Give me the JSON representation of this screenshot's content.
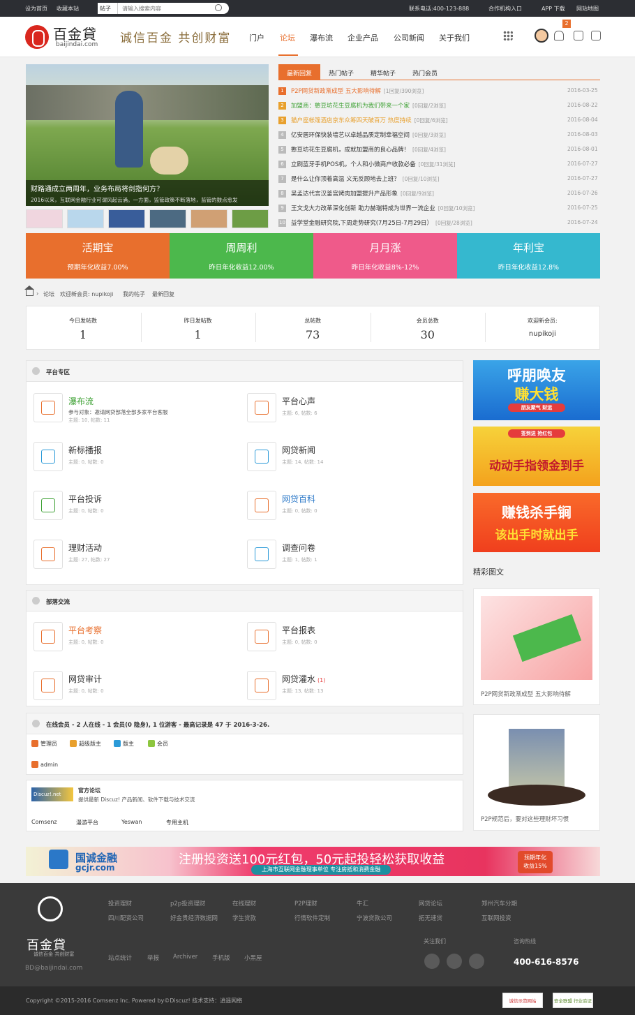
{
  "topbar": {
    "set_home": "设为首页",
    "bookmark": "收藏本站",
    "search_scope": "帖子",
    "search_placeholder": "请输入搜索内容",
    "phone": "联系电话:400-123-888",
    "partner": "合作机构入口",
    "app": "APP 下载",
    "sitemap": "网站地图"
  },
  "header": {
    "logo_text": "百金貸",
    "logo_domain": "baijindai.com",
    "slogan": "诚信百金 共创财富",
    "nav": [
      "门户",
      "论坛",
      "瀑布流",
      "企业产品",
      "公司新闻",
      "关于我们"
    ],
    "notif_count": "2"
  },
  "slider": {
    "title": "财路通成立两周年，业务布局将剑指何方？",
    "desc": "2016以来，互联网金融行业可谓风起云涌。一方面，监管政策不断落地，监管的鼓点愈发"
  },
  "tabs": [
    "最新回复",
    "热门帖子",
    "精华帖子",
    "热门会员"
  ],
  "latest": [
    {
      "n": "1",
      "title": "P2P网贷新政渐成型 五大影响待解",
      "meta": "[1回复/390浏览]",
      "date": "2016-03-25",
      "color": "#e86f2d"
    },
    {
      "n": "2",
      "title": "加盟商：憨豆坊花生豆腐机为我们带来一个家",
      "meta": "[0回复/2浏览]",
      "date": "2016-08-22",
      "color": "#3fa135"
    },
    {
      "n": "3",
      "title": "猫户座帐篷酒店京东众筹四天破百万 热度持续",
      "meta": "[0回复/6浏览]",
      "date": "2016-08-04",
      "color": "#e8a02d"
    },
    {
      "n": "4",
      "title": "亿安居环保快装墙艺以卓越品质定制幸福空间",
      "meta": "[0回复/3浏览]",
      "date": "2016-08-03",
      "color": "#333"
    },
    {
      "n": "5",
      "title": "憨豆坊花生豆腐机，成就加盟商的良心品牌！",
      "meta": "[0回复/4浏览]",
      "date": "2016-08-01",
      "color": "#333"
    },
    {
      "n": "6",
      "title": "立刷蓝牙手机POS机，个人和小微商户收款必备",
      "meta": "[0回复/31浏览]",
      "date": "2016-07-27",
      "color": "#333"
    },
    {
      "n": "7",
      "title": "是什么让你顶着高温 义无反顾地去上班？",
      "meta": "[0回复/10浏览]",
      "date": "2016-07-27",
      "color": "#333"
    },
    {
      "n": "8",
      "title": "吴孟达代言汉釜宫烤肉加盟提升产品形象",
      "meta": "[0回复/9浏览]",
      "date": "2016-07-26",
      "color": "#333"
    },
    {
      "n": "9",
      "title": "王文戈大力改革深化创新 助力赫瑞特成为世界一流企业",
      "meta": "[0回复/10浏览]",
      "date": "2016-07-25",
      "color": "#333"
    },
    {
      "n": "10",
      "title": "益学堂金融研究院,下周走势研究(7月25日-7月29日）",
      "meta": "[0回复/28浏览]",
      "date": "2016-07-24",
      "color": "#333"
    }
  ],
  "products": [
    {
      "name": "活期宝",
      "rate": "预期年化收益7.00%",
      "color": "#e86f2d"
    },
    {
      "name": "周周利",
      "rate": "昨日年化收益12.00%",
      "color": "#4cb84c"
    },
    {
      "name": "月月涨",
      "rate": "昨日年化收益8%-12%",
      "color": "#ef5a8a"
    },
    {
      "name": "年利宝",
      "rate": "昨日年化收益12.8%",
      "color": "#35b8cf"
    }
  ],
  "breadcrumb": {
    "forum": "论坛",
    "welcome": "欢迎新会员: nupikoji",
    "my_posts": "我的帖子",
    "latest": "最新回复"
  },
  "stats": [
    {
      "label": "今日发帖数",
      "value": "1"
    },
    {
      "label": "昨日发帖数",
      "value": "1"
    },
    {
      "label": "总帖数",
      "value": "73"
    },
    {
      "label": "会员总数",
      "value": "30"
    },
    {
      "label": "欢迎新会员:",
      "value": "nupikoji"
    }
  ],
  "sections": {
    "platform": "平台专区",
    "tribe": "部落交流"
  },
  "platform_forums": [
    {
      "name": "瀑布流",
      "meta": "主题: 10, 帖数: 11",
      "desc": "参与对象：邀请网贷部落全部多家平台客服",
      "color": "#3fa135"
    },
    {
      "name": "平台心声",
      "meta": "主题: 6, 帖数: 6",
      "desc": "",
      "color": "#333"
    },
    {
      "name": "新标播报",
      "meta": "主题: 0, 帖数: 0",
      "desc": "",
      "color": "#333"
    },
    {
      "name": "网贷新闻",
      "meta": "主题: 14, 帖数: 14",
      "desc": "",
      "color": "#333"
    },
    {
      "name": "平台投诉",
      "meta": "主题: 0, 帖数: 0",
      "desc": "",
      "color": "#333"
    },
    {
      "name": "网贷百科",
      "meta": "主题: 0, 帖数: 0",
      "desc": "",
      "color": "#2b78c8"
    },
    {
      "name": "理财活动",
      "meta": "主题: 27, 帖数: 27",
      "desc": "",
      "color": "#333"
    },
    {
      "name": "调查问卷",
      "meta": "主题: 1, 帖数: 1",
      "desc": "",
      "color": "#333"
    }
  ],
  "tribe_forums": [
    {
      "name": "平台考察",
      "meta": "主题: 0, 帖数: 0",
      "color": "#e86f2d",
      "extra": ""
    },
    {
      "name": "平台报表",
      "meta": "主题: 0, 帖数: 0",
      "color": "#333",
      "extra": ""
    },
    {
      "name": "网贷审计",
      "meta": "主题: 0, 帖数: 0",
      "color": "#333",
      "extra": ""
    },
    {
      "name": "网贷灌水",
      "meta": "主题: 13, 帖数: 13",
      "color": "#333",
      "extra": "(1)"
    }
  ],
  "online": {
    "summary": "在线会员 - 2 人在线 - 1 会员(0 隐身), 1 位游客 - 最高记录是 47 于 2016-3-26.",
    "roles": [
      "管理员",
      "超级版主",
      "版主",
      "会员"
    ],
    "users": [
      "admin"
    ]
  },
  "links": {
    "official_title": "官方论坛",
    "official_desc": "提供最新 Discuz! 产品新闻、软件下载与技术交流",
    "logo_text": "Discuz!.net",
    "items": [
      "Comsenz",
      "漫游平台",
      "Yeswan",
      "专用主机"
    ]
  },
  "sidebar": {
    "ads": [
      {
        "line1": "呼朋唤友",
        "line2": "赚大钱",
        "line3": "朋友聚气 财运"
      },
      {
        "line1": "签到送 抢红包",
        "line2": "动动手指领金到手"
      },
      {
        "line1": "赚钱杀手锏",
        "line2": "该出手时就出手"
      }
    ],
    "section_title": "精彩图文",
    "pics": [
      "P2P网贷新政渐成型 五大影响待解",
      "P2P规范后，要对这些理财坏习惯"
    ]
  },
  "banner": {
    "brand": "国诚金融",
    "domain": "gcjr.com",
    "main": "注册投资送100元红包，50元起投轻松获取收益",
    "sub": "上海市互联网金融理事单位 专注房抵和消费金融",
    "badge1": "预期年化",
    "badge2": "收益15%"
  },
  "footer": {
    "logo_text": "百金貸",
    "slogan": "诚信百金 共创财富",
    "email": "BD@baijindai.com",
    "links_row1": [
      "投资理财",
      "p2p投资理财",
      "在线理财",
      "P2P理财",
      "牛汇",
      "网贷论坛",
      "郑州汽车分期"
    ],
    "links_row2": [
      "四川配资公司",
      "好金贵经济数据网",
      "学生贷款",
      "行情软件定制",
      "宁波贷款公司",
      "拓无速贷",
      "互联网投资"
    ],
    "links_row3": [
      "站点统计",
      "举报",
      "Archiver",
      "手机版",
      "小黑屋"
    ],
    "follow": "关注我们",
    "hotline_label": "咨询热线",
    "hotline": "400-616-8576",
    "copyright": "Copyright  ©2015-2016  Comsenz Inc.  Powered by©Discuz!  技术支持：逍遥网络",
    "cert1": "诚信示范网站",
    "cert2": "安全联盟 行业验证"
  }
}
